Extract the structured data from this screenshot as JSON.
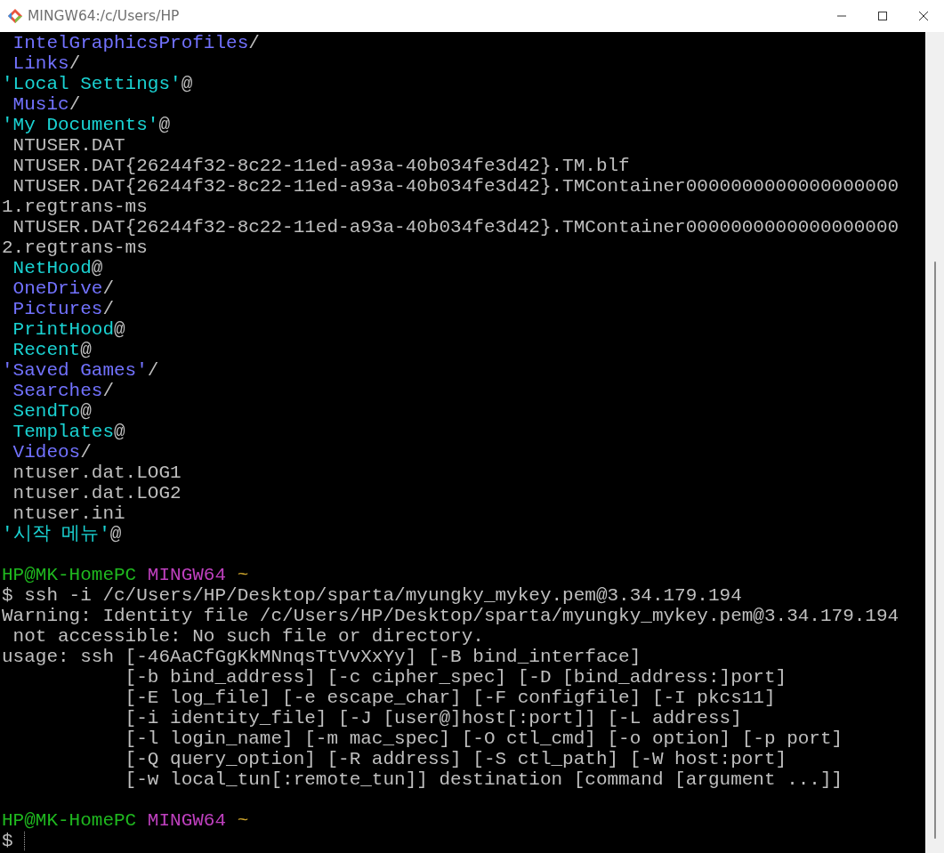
{
  "window": {
    "title": "MINGW64:/c/Users/HP"
  },
  "lines": [
    {
      "kind": "output",
      "segments": [
        {
          "text": " IntelGraphicsProfiles",
          "kind": "dir"
        },
        {
          "text": "/",
          "kind": "plain"
        }
      ]
    },
    {
      "kind": "output",
      "segments": [
        {
          "text": " Links",
          "kind": "dir"
        },
        {
          "text": "/",
          "kind": "plain"
        }
      ]
    },
    {
      "kind": "output",
      "segments": [
        {
          "text": "'Local Settings'",
          "kind": "link"
        },
        {
          "text": "@",
          "kind": "plain"
        }
      ]
    },
    {
      "kind": "output",
      "segments": [
        {
          "text": " Music",
          "kind": "dir"
        },
        {
          "text": "/",
          "kind": "plain"
        }
      ]
    },
    {
      "kind": "output",
      "segments": [
        {
          "text": "'My Documents'",
          "kind": "link"
        },
        {
          "text": "@",
          "kind": "plain"
        }
      ]
    },
    {
      "kind": "output",
      "segments": [
        {
          "text": " NTUSER.DAT",
          "kind": "plain"
        }
      ]
    },
    {
      "kind": "output",
      "segments": [
        {
          "text": " NTUSER.DAT{26244f32-8c22-11ed-a93a-40b034fe3d42}.TM.blf",
          "kind": "plain"
        }
      ]
    },
    {
      "kind": "output",
      "segments": [
        {
          "text": " NTUSER.DAT{26244f32-8c22-11ed-a93a-40b034fe3d42}.TMContainer0000000000000000000",
          "kind": "plain"
        }
      ]
    },
    {
      "kind": "output",
      "segments": [
        {
          "text": "1.regtrans-ms",
          "kind": "plain"
        }
      ]
    },
    {
      "kind": "output",
      "segments": [
        {
          "text": " NTUSER.DAT{26244f32-8c22-11ed-a93a-40b034fe3d42}.TMContainer0000000000000000000",
          "kind": "plain"
        }
      ]
    },
    {
      "kind": "output",
      "segments": [
        {
          "text": "2.regtrans-ms",
          "kind": "plain"
        }
      ]
    },
    {
      "kind": "output",
      "segments": [
        {
          "text": " NetHood",
          "kind": "link"
        },
        {
          "text": "@",
          "kind": "plain"
        }
      ]
    },
    {
      "kind": "output",
      "segments": [
        {
          "text": " OneDrive",
          "kind": "dir"
        },
        {
          "text": "/",
          "kind": "plain"
        }
      ]
    },
    {
      "kind": "output",
      "segments": [
        {
          "text": " Pictures",
          "kind": "dir"
        },
        {
          "text": "/",
          "kind": "plain"
        }
      ]
    },
    {
      "kind": "output",
      "segments": [
        {
          "text": " PrintHood",
          "kind": "link"
        },
        {
          "text": "@",
          "kind": "plain"
        }
      ]
    },
    {
      "kind": "output",
      "segments": [
        {
          "text": " Recent",
          "kind": "link"
        },
        {
          "text": "@",
          "kind": "plain"
        }
      ]
    },
    {
      "kind": "output",
      "segments": [
        {
          "text": "'Saved Games'",
          "kind": "dir"
        },
        {
          "text": "/",
          "kind": "plain"
        }
      ]
    },
    {
      "kind": "output",
      "segments": [
        {
          "text": " Searches",
          "kind": "dir"
        },
        {
          "text": "/",
          "kind": "plain"
        }
      ]
    },
    {
      "kind": "output",
      "segments": [
        {
          "text": " SendTo",
          "kind": "link"
        },
        {
          "text": "@",
          "kind": "plain"
        }
      ]
    },
    {
      "kind": "output",
      "segments": [
        {
          "text": " Templates",
          "kind": "link"
        },
        {
          "text": "@",
          "kind": "plain"
        }
      ]
    },
    {
      "kind": "output",
      "segments": [
        {
          "text": " Videos",
          "kind": "dir"
        },
        {
          "text": "/",
          "kind": "plain"
        }
      ]
    },
    {
      "kind": "output",
      "segments": [
        {
          "text": " ntuser.dat.LOG1",
          "kind": "plain"
        }
      ]
    },
    {
      "kind": "output",
      "segments": [
        {
          "text": " ntuser.dat.LOG2",
          "kind": "plain"
        }
      ]
    },
    {
      "kind": "output",
      "segments": [
        {
          "text": " ntuser.ini",
          "kind": "plain"
        }
      ]
    },
    {
      "kind": "output",
      "segments": [
        {
          "text": "'시작 메뉴'",
          "kind": "link"
        },
        {
          "text": "@",
          "kind": "plain"
        }
      ]
    },
    {
      "kind": "blank"
    },
    {
      "kind": "output",
      "segments": [
        {
          "text": "HP@MK-HomePC ",
          "kind": "user"
        },
        {
          "text": "MINGW64 ",
          "kind": "host"
        },
        {
          "text": "~",
          "kind": "path"
        }
      ]
    },
    {
      "kind": "output",
      "segments": [
        {
          "text": "$ ssh -i /c/Users/HP/Desktop/sparta/myungky_mykey.pem@3.34.179.194",
          "kind": "plain"
        }
      ]
    },
    {
      "kind": "output",
      "segments": [
        {
          "text": "Warning: Identity file /c/Users/HP/Desktop/sparta/myungky_mykey.pem@3.34.179.194",
          "kind": "plain"
        }
      ]
    },
    {
      "kind": "output",
      "segments": [
        {
          "text": " not accessible: No such file or directory.",
          "kind": "plain"
        }
      ]
    },
    {
      "kind": "output",
      "segments": [
        {
          "text": "usage: ssh [-46AaCfGgKkMNnqsTtVvXxYy] [-B bind_interface]",
          "kind": "plain"
        }
      ]
    },
    {
      "kind": "output",
      "segments": [
        {
          "text": "           [-b bind_address] [-c cipher_spec] [-D [bind_address:]port]",
          "kind": "plain"
        }
      ]
    },
    {
      "kind": "output",
      "segments": [
        {
          "text": "           [-E log_file] [-e escape_char] [-F configfile] [-I pkcs11]",
          "kind": "plain"
        }
      ]
    },
    {
      "kind": "output",
      "segments": [
        {
          "text": "           [-i identity_file] [-J [user@]host[:port]] [-L address]",
          "kind": "plain"
        }
      ]
    },
    {
      "kind": "output",
      "segments": [
        {
          "text": "           [-l login_name] [-m mac_spec] [-O ctl_cmd] [-o option] [-p port]",
          "kind": "plain"
        }
      ]
    },
    {
      "kind": "output",
      "segments": [
        {
          "text": "           [-Q query_option] [-R address] [-S ctl_path] [-W host:port]",
          "kind": "plain"
        }
      ]
    },
    {
      "kind": "output",
      "segments": [
        {
          "text": "           [-w local_tun[:remote_tun]] destination [command [argument ...]]",
          "kind": "plain"
        }
      ]
    },
    {
      "kind": "blank"
    },
    {
      "kind": "output",
      "segments": [
        {
          "text": "HP@MK-HomePC ",
          "kind": "user"
        },
        {
          "text": "MINGW64 ",
          "kind": "host"
        },
        {
          "text": "~",
          "kind": "path"
        }
      ]
    },
    {
      "kind": "input",
      "segments": [
        {
          "text": "$",
          "kind": "plain"
        }
      ]
    }
  ]
}
